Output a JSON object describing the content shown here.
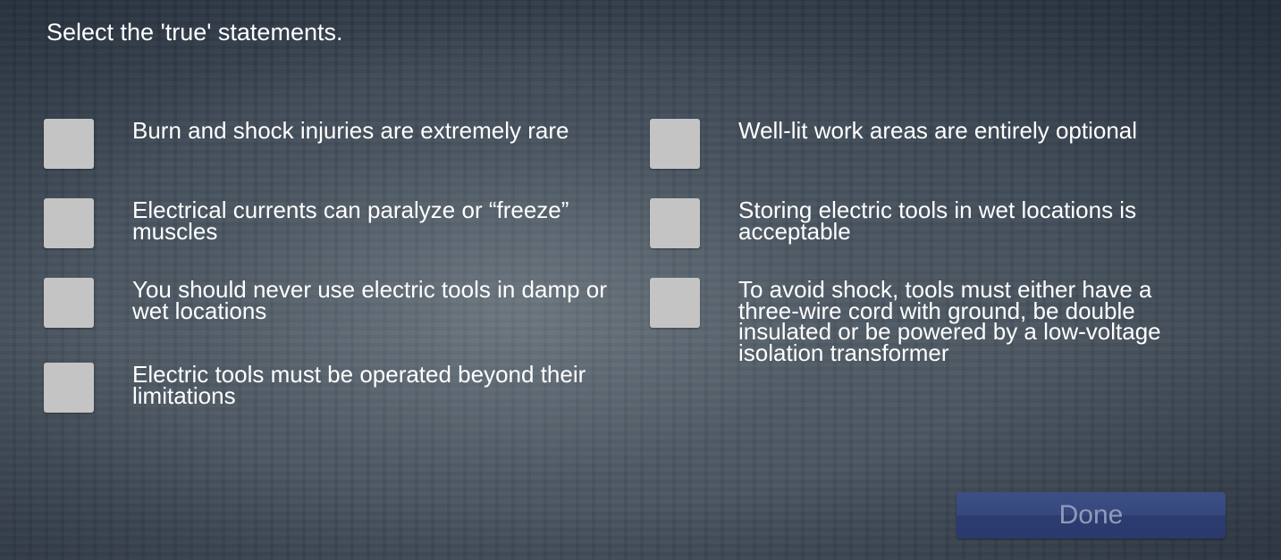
{
  "prompt": "Select the 'true' statements.",
  "options": [
    {
      "label": "Burn and shock injuries are extremely rare",
      "checked": false
    },
    {
      "label": "Electrical currents can paralyze or “freeze” muscles",
      "checked": false
    },
    {
      "label": "You should never use electric tools in damp or wet locations",
      "checked": false
    },
    {
      "label": "Electric tools must be operated beyond their limitations",
      "checked": false
    },
    {
      "label": "Well-lit work areas are entirely optional",
      "checked": false
    },
    {
      "label": "Storing electric tools in wet locations is acceptable",
      "checked": false
    },
    {
      "label": "To avoid shock, tools must either have a three-wire cord with ground, be double insulated or be powered by a low-voltage isolation transformer",
      "checked": false
    }
  ],
  "done_button": {
    "label": "Done",
    "enabled": false
  },
  "colors": {
    "checkbox": "#c4c4c4",
    "button": "#36477c",
    "button_text_disabled": "#8e9ab8"
  }
}
